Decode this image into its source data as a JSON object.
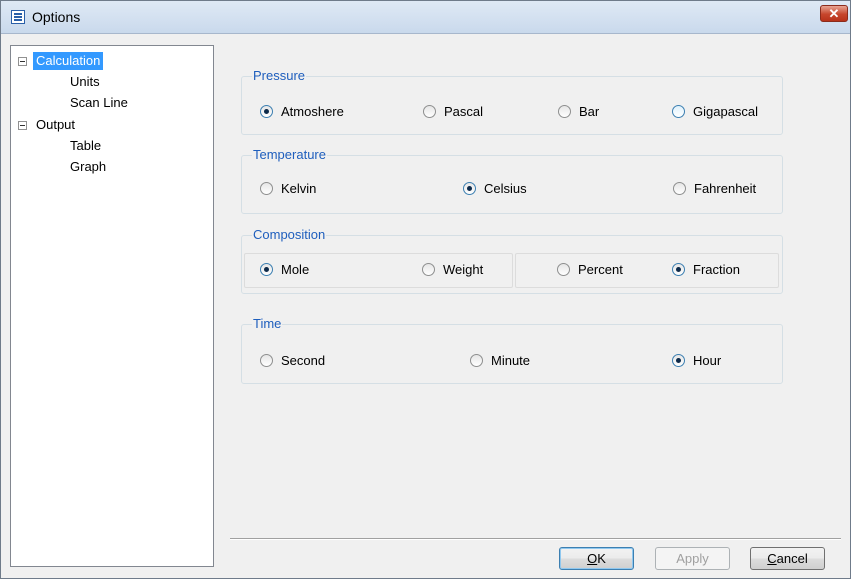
{
  "window": {
    "title": "Options",
    "close_label": "✕"
  },
  "tree": {
    "calculation": {
      "label": "Calculation",
      "expander": "⊟",
      "children": [
        "Units",
        "Scan Line"
      ]
    },
    "output": {
      "label": "Output",
      "expander": "⊟",
      "children": [
        "Table",
        "Graph"
      ]
    }
  },
  "pressure": {
    "title": "Pressure",
    "options": [
      "Atmoshere",
      "Pascal",
      "Bar",
      "Gigapascal"
    ],
    "selected": "Atmoshere"
  },
  "temperature": {
    "title": "Temperature",
    "options": [
      "Kelvin",
      "Celsius",
      "Fahrenheit"
    ],
    "selected": "Celsius"
  },
  "composition": {
    "title": "Composition",
    "basis_options": [
      "Mole",
      "Weight"
    ],
    "basis_selected": "Mole",
    "format_options": [
      "Percent",
      "Fraction"
    ],
    "format_selected": "Fraction"
  },
  "time": {
    "title": "Time",
    "options": [
      "Second",
      "Minute",
      "Hour"
    ],
    "selected": "Hour"
  },
  "buttons": {
    "ok": {
      "mnemonic": "O",
      "rest": "K"
    },
    "apply": {
      "mnemonic": "",
      "rest": "Apply"
    },
    "cancel": {
      "mnemonic": "C",
      "rest": "ancel"
    }
  }
}
